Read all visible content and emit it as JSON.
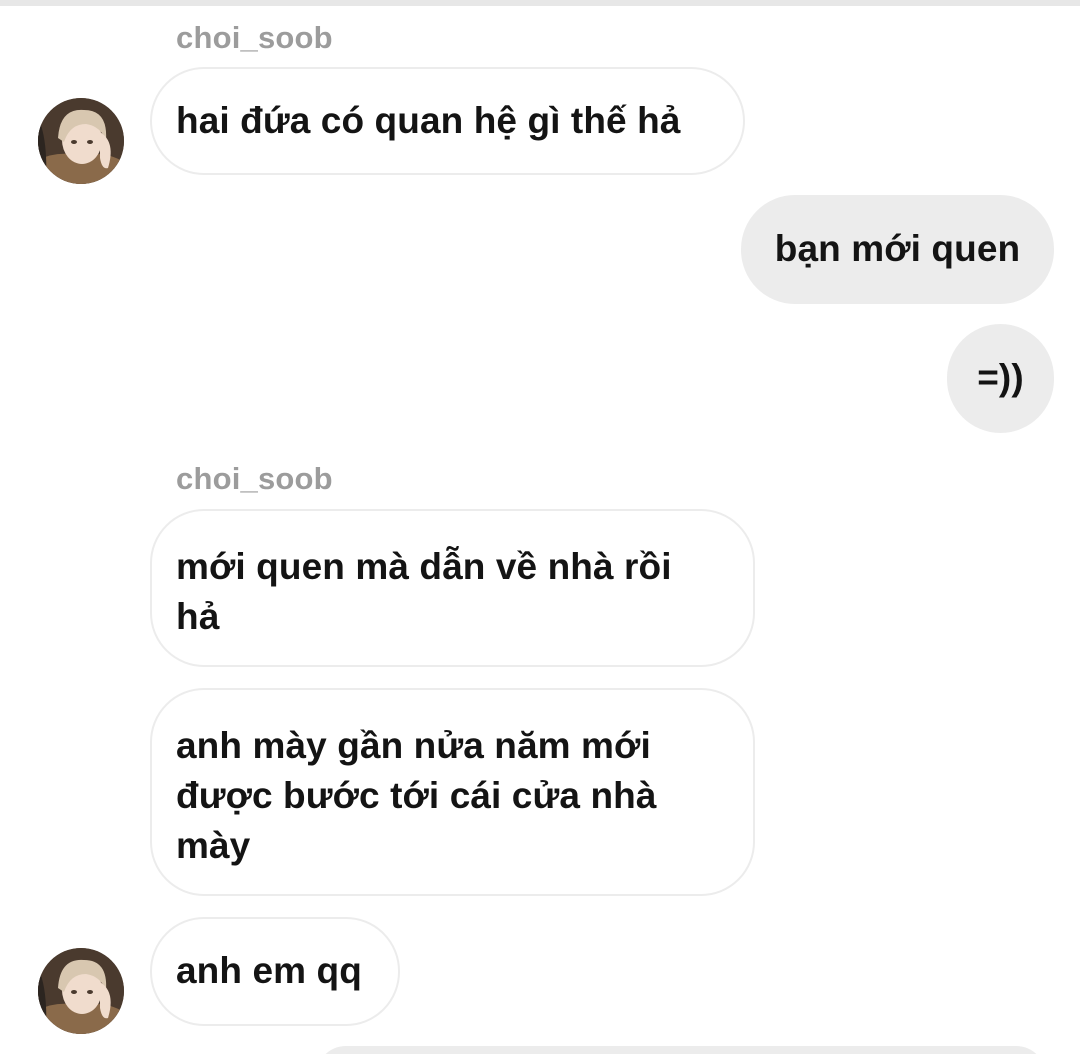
{
  "conversation": {
    "messages": [
      {
        "id": 1,
        "direction": "incoming",
        "sender": "choi_soob",
        "text": "hai đứa có quan hệ gì thế hả"
      },
      {
        "id": 2,
        "direction": "outgoing",
        "text": "bạn mới quen"
      },
      {
        "id": 3,
        "direction": "outgoing",
        "text": "=))"
      },
      {
        "id": 4,
        "direction": "incoming",
        "sender": "choi_soob",
        "text": "mới quen mà dẫn về nhà rồi hả"
      },
      {
        "id": 5,
        "direction": "incoming",
        "text": "anh mày gần nửa năm mới được bước tới cái cửa nhà mày"
      },
      {
        "id": 6,
        "direction": "incoming",
        "text": "anh em qq"
      }
    ]
  },
  "avatar": {
    "icon": "profile-photo",
    "colors": {
      "background": "#5b4636",
      "hair": "#d8c7b0",
      "skin": "#f0dccd",
      "jacket": "#8a6a4a"
    }
  },
  "colors": {
    "incoming_bubble_border": "#ececec",
    "outgoing_bubble_bg": "#ececec",
    "sender_name": "#9c9c9c",
    "message_text": "#141414"
  }
}
